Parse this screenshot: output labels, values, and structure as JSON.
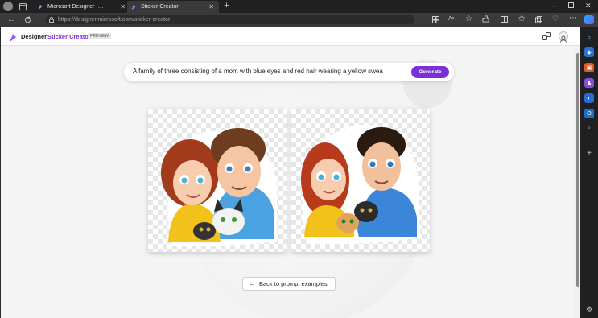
{
  "browser": {
    "tabs": [
      {
        "label": "Microsoft Designer - Stunning d"
      },
      {
        "label": "Sticker Creator"
      }
    ],
    "url": "https://designer.microsoft.com/sticker-creator"
  },
  "header": {
    "brand": "Designer",
    "product": "Sticker Creator",
    "badge": "PREVIEW"
  },
  "prompt": {
    "text": "A family of three consisting of a mom with blue eyes and red hair wearing a yellow swea",
    "generate_label": "Generate"
  },
  "back_label": "Back to prompt examples",
  "colors": {
    "accent": "#7b2fd8",
    "browser_bg": "#202020",
    "page_bg": "#f4f4f4"
  }
}
